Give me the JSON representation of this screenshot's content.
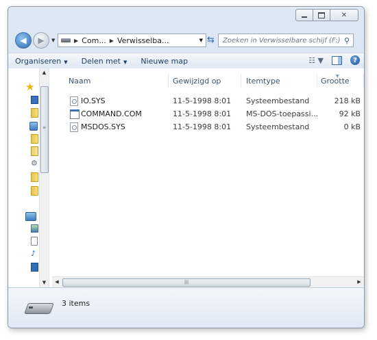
{
  "window": {
    "caption_buttons": [
      "minimize",
      "maximize",
      "close"
    ]
  },
  "address": {
    "crumbs": [
      "Com...",
      "Verwisselba..."
    ],
    "search_placeholder": "Zoeken in Verwisselbare schijf (F:)"
  },
  "toolbar": {
    "organize": "Organiseren",
    "share": "Delen met",
    "new_folder": "Nieuwe map"
  },
  "columns": {
    "name": "Naam",
    "modified": "Gewijzigd op",
    "type": "Itemtype",
    "size": "Grootte"
  },
  "files": [
    {
      "name": "IO.SYS",
      "modified": "11-5-1998 8:01",
      "type": "Systeembestand",
      "size": "218 kB",
      "icon": "system-file-icon"
    },
    {
      "name": "COMMAND.COM",
      "modified": "11-5-1998 8:01",
      "type": "MS-DOS-toepassi...",
      "size": "92 kB",
      "icon": "ms-dos-app-icon"
    },
    {
      "name": "MSDOS.SYS",
      "modified": "11-5-1998 8:01",
      "type": "Systeembestand",
      "size": "0 kB",
      "icon": "system-file-icon"
    }
  ],
  "status": {
    "items": "3 items"
  },
  "nav_icons": [
    "favorites-star-icon",
    "desktop-icon",
    "folder-icon",
    "library-icon",
    "folder-icon",
    "pencil-folder-icon",
    "network-icon",
    "folder-icon",
    "folder-icon",
    "libraries-icon",
    "pictures-icon",
    "documents-icon",
    "music-icon",
    "videos-icon"
  ]
}
